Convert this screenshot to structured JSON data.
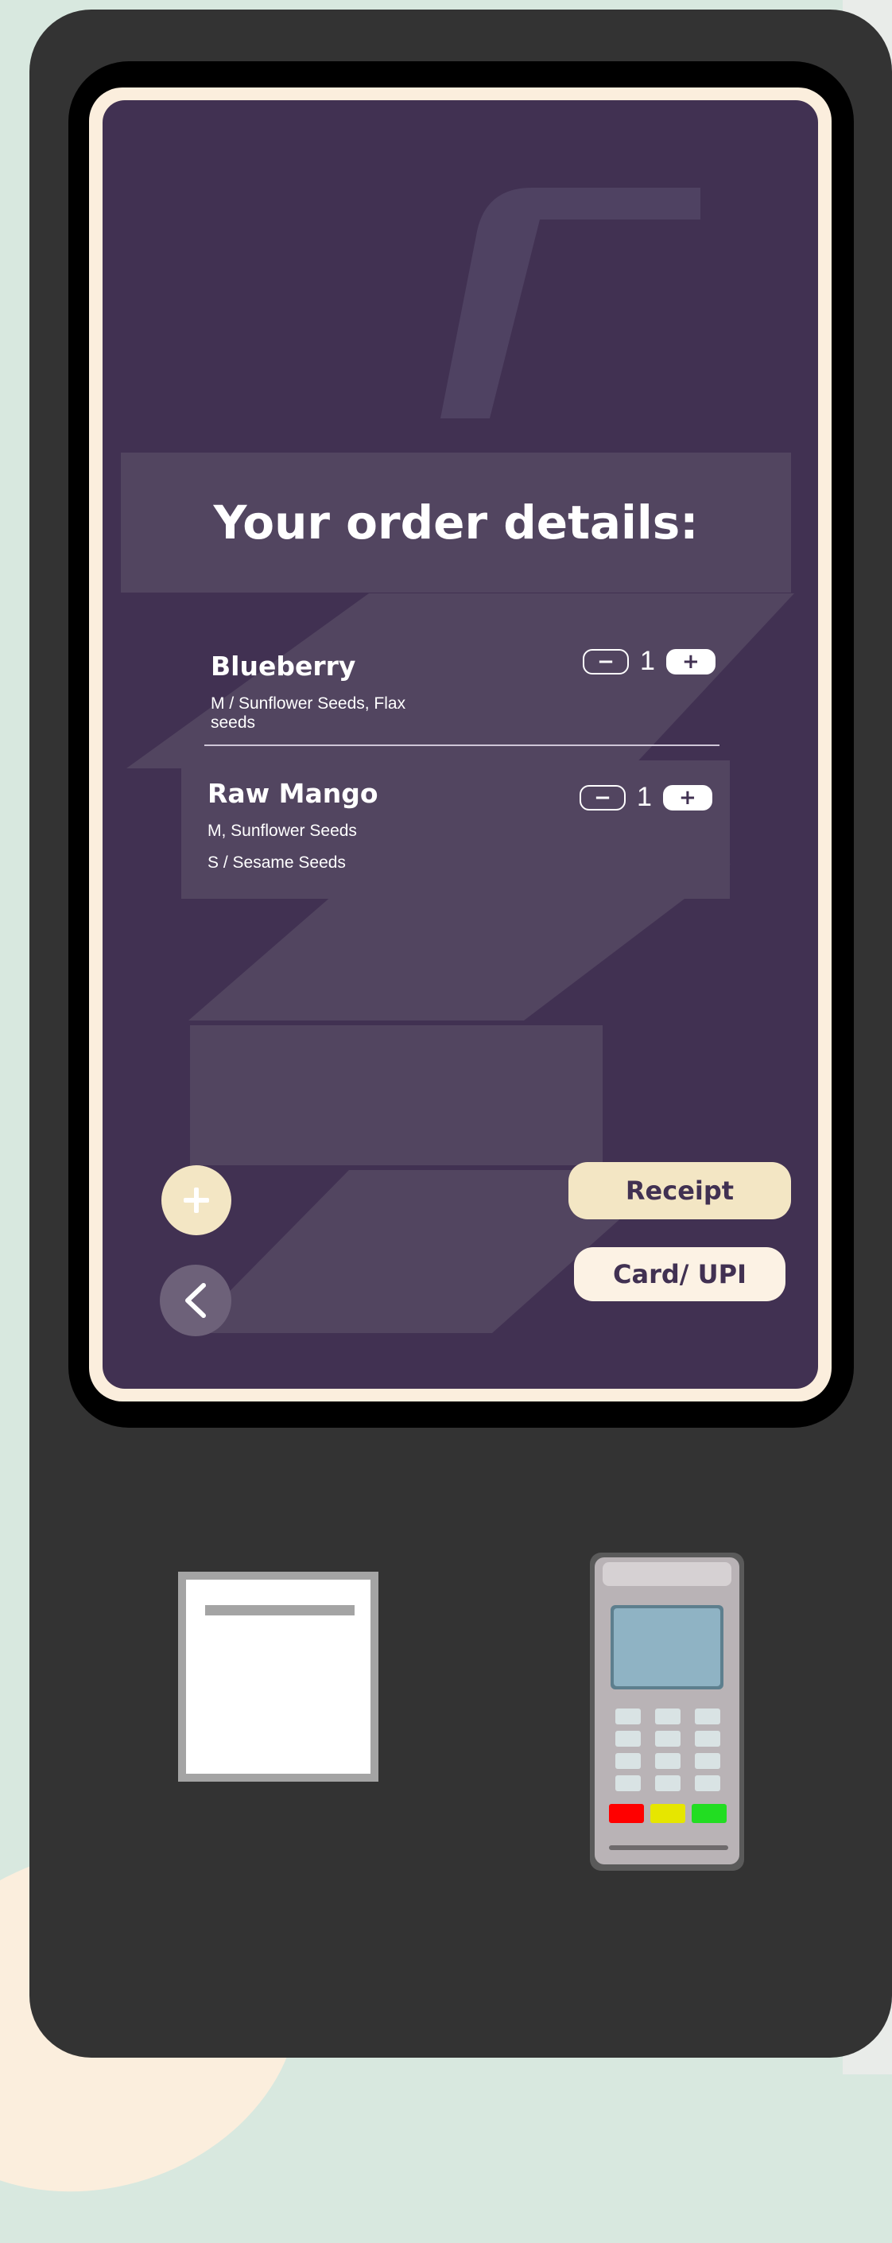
{
  "page": {
    "title": "Your order details:"
  },
  "order": {
    "items": [
      {
        "name": "Blueberry",
        "details": [
          "M / Sunflower Seeds, Flax",
          "seeds"
        ],
        "quantity": "1",
        "minus_label": "−",
        "plus_label": "+"
      },
      {
        "name": "Raw Mango",
        "details": [
          "M, Sunflower Seeds",
          "S / Sesame Seeds"
        ],
        "quantity": "1",
        "minus_label": "−",
        "plus_label": "+"
      }
    ]
  },
  "actions": {
    "receipt_label": "Receipt",
    "payment_label": "Card/ UPI",
    "add_icon": "plus-icon",
    "back_icon": "chevron-left-icon"
  },
  "colors": {
    "screen_bg": "#413152",
    "panel": "#524560",
    "accent_cream": "#f3e6c4",
    "kiosk_body": "#333333"
  }
}
